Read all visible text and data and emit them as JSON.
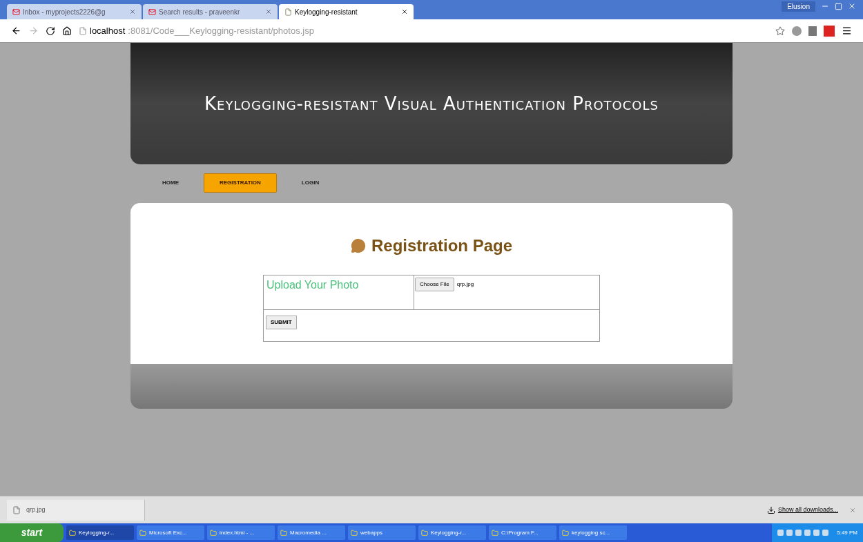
{
  "browser": {
    "tabs": [
      {
        "title": "Inbox - myprojects2226@g",
        "kind": "mail",
        "selected": false
      },
      {
        "title": "Search results - praveenkr",
        "kind": "mail",
        "selected": false
      },
      {
        "title": "Keylogging-resistant",
        "kind": "page",
        "selected": true
      }
    ],
    "user": "Elusion",
    "address": {
      "host": "localhost",
      "path": ":8081/Code___Keylogging-resistant/photos.jsp"
    }
  },
  "page": {
    "banner_title": "Keylogging-resistant Visual Authentication Protocols",
    "nav": [
      {
        "label": "HOME",
        "selected": false
      },
      {
        "label": "REGISTRATION",
        "selected": true
      },
      {
        "label": "LOGIN",
        "selected": false
      }
    ],
    "heading": "Registration Page",
    "form": {
      "label": "Upload Your Photo",
      "choose_button": "Choose File",
      "file_name": "qrp.jpg",
      "submit": "SUBMIT"
    }
  },
  "downloads": {
    "file": "qrp.jpg",
    "show_all": "Show all downloads..."
  },
  "taskbar": {
    "start": "start",
    "items": [
      {
        "label": "Keylogging-r...",
        "selected": true
      },
      {
        "label": "Microsoft Exc...",
        "selected": false
      },
      {
        "label": "index.html - ...",
        "selected": false
      },
      {
        "label": "Macromedia ...",
        "selected": false
      },
      {
        "label": "webapps",
        "selected": false
      },
      {
        "label": "Keylogging-r...",
        "selected": false
      },
      {
        "label": "C:\\Program F...",
        "selected": false
      },
      {
        "label": "keylogging sc...",
        "selected": false
      }
    ],
    "clock": "5:49 PM"
  }
}
